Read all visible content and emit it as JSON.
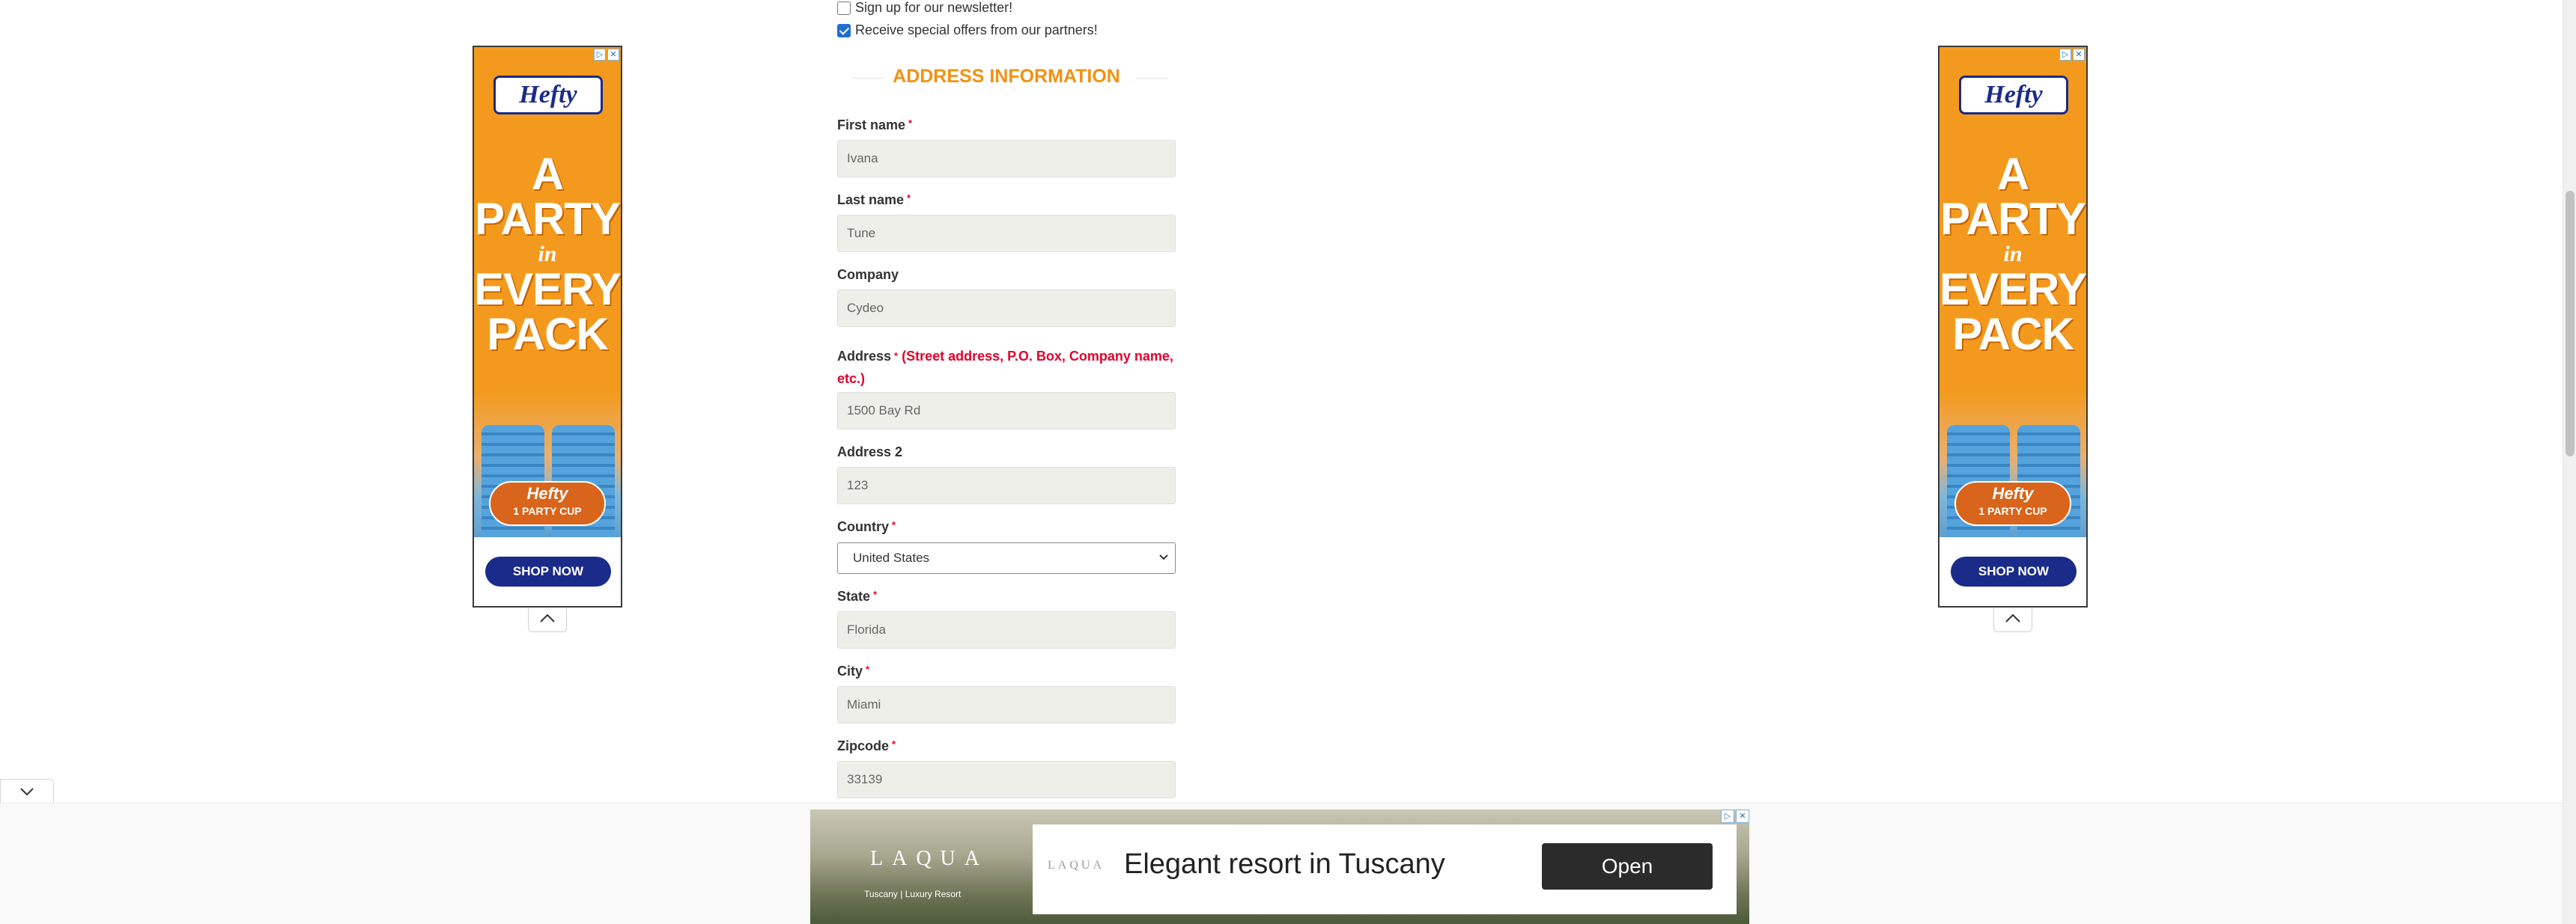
{
  "form": {
    "newsletter": {
      "label": "Sign up for our newsletter!",
      "checked": false
    },
    "partners": {
      "label": "Receive special offers from our partners!",
      "checked": true
    },
    "section_title": "ADDRESS INFORMATION",
    "required_marker": "*",
    "fields": {
      "first_name": {
        "label": "First name",
        "value": "Ivana"
      },
      "last_name": {
        "label": "Last name",
        "value": "Tune"
      },
      "company": {
        "label": "Company",
        "value": "Cydeo"
      },
      "address": {
        "label": "Address",
        "hint": "(Street address, P.O. Box, Company name, etc.)",
        "value": "1500 Bay Rd"
      },
      "address2": {
        "label": "Address 2",
        "value": "123"
      },
      "country": {
        "label": "Country",
        "value": "United States"
      },
      "state": {
        "label": "State",
        "value": "Florida"
      },
      "city": {
        "label": "City",
        "value": "Miami"
      },
      "zipcode": {
        "label": "Zipcode",
        "value": "33139"
      }
    }
  },
  "side_ad": {
    "brand": "Hefty",
    "headline_1": "A",
    "headline_2": "PARTY",
    "headline_3": "in",
    "headline_4": "EVERY",
    "headline_5": "PACK",
    "cup_brand": "Hefty",
    "cup_sub": "1 PARTY CUP",
    "cta": "SHOP NOW",
    "accent_color": "#f39a1e",
    "brand_color": "#1a2b8a"
  },
  "bottom_ad": {
    "left_logo": "LAQUA",
    "left_tagline": "Tuscany | Luxury Resort",
    "mini_logo": "LAQUA",
    "headline": "Elegant resort in Tuscany",
    "cta": "Open"
  },
  "icons": {
    "ad_choices": "ad-choices-icon",
    "ad_close": "close-icon",
    "collapse_up": "chevron-up-icon",
    "collapse_down": "chevron-down-icon",
    "select_arrow": "chevron-down-icon"
  }
}
